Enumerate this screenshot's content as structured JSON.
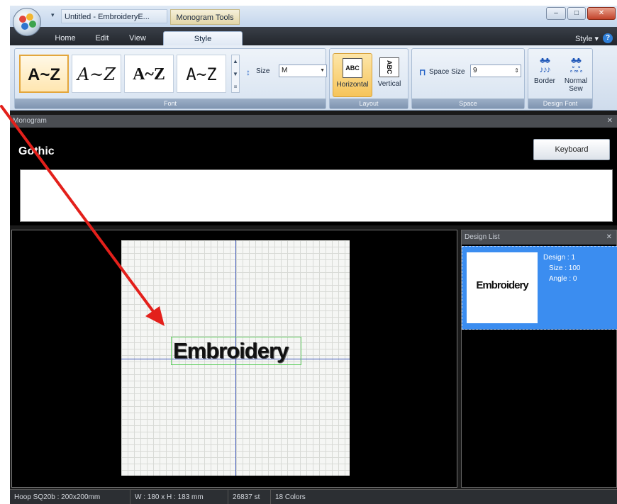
{
  "window": {
    "doc_title": "Untitled - EmbroideryE...",
    "context_tab": "Monogram Tools",
    "controls": [
      "–",
      "□",
      "✕"
    ]
  },
  "ribbon_tabs": {
    "home": "Home",
    "edit": "Edit",
    "view": "View",
    "style": "Style",
    "style_menu": "Style  ▾",
    "help": "?"
  },
  "font_group": {
    "label": "Font",
    "tiles": [
      "A~Z",
      "A~Z",
      "A~Z",
      "A~Z"
    ],
    "size_label": "Size",
    "size_value": "M"
  },
  "layout_group": {
    "label": "Layout",
    "horizontal_label": "Horizontal",
    "vertical_label": "Vertical",
    "abc": "ABC"
  },
  "space_group": {
    "label": "Space",
    "space_size_label": "Space Size",
    "space_size_value": "9"
  },
  "design_font_group": {
    "label": "Design Font",
    "border_label": "Border",
    "normal_sew_label": "Normal Sew"
  },
  "monogram_panel": {
    "title": "Monogram",
    "close": "✕",
    "font_name": "Gothic",
    "keyboard_button": "Keyboard",
    "input_value": ""
  },
  "canvas": {
    "design_text": "Embroidery"
  },
  "design_list": {
    "title": "Design List",
    "close": "✕",
    "items": [
      {
        "thumb_text": "Embroidery",
        "design": "Design : 1",
        "size": "Size : 100",
        "angle": "Angle : 0"
      }
    ]
  },
  "status": {
    "hoop": "Hoop SQ20b : 200x200mm",
    "dimensions": "W : 180 x H : 183 mm",
    "stitches": "26837 st",
    "colors": "18 Colors"
  },
  "colors": {
    "accent_selected": "#f6c45a",
    "design_list_highlight": "#3b8df0",
    "annotation_arrow": "#e3201b",
    "axis_line": "#3c55b8"
  },
  "icons": {
    "app_orb": "embroidery-app-logo-icon",
    "size": "size-icon",
    "space": "space-size-icon",
    "border": "border-icon",
    "normal_sew": "normal-sew-icon"
  }
}
